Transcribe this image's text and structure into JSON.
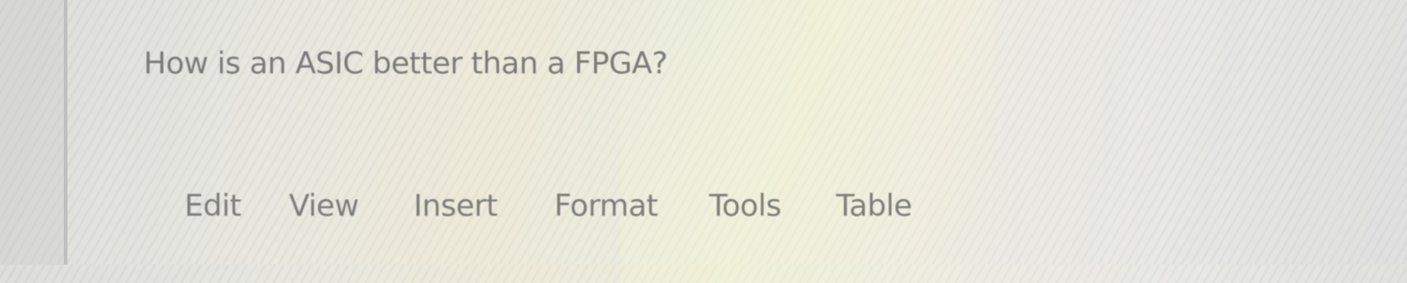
{
  "question": {
    "text": "How is an ASIC better than a FPGA?"
  },
  "menubar": {
    "items": [
      {
        "label": "Edit"
      },
      {
        "label": "View"
      },
      {
        "label": "Insert"
      },
      {
        "label": "Format"
      },
      {
        "label": "Tools"
      },
      {
        "label": "Table"
      }
    ]
  }
}
